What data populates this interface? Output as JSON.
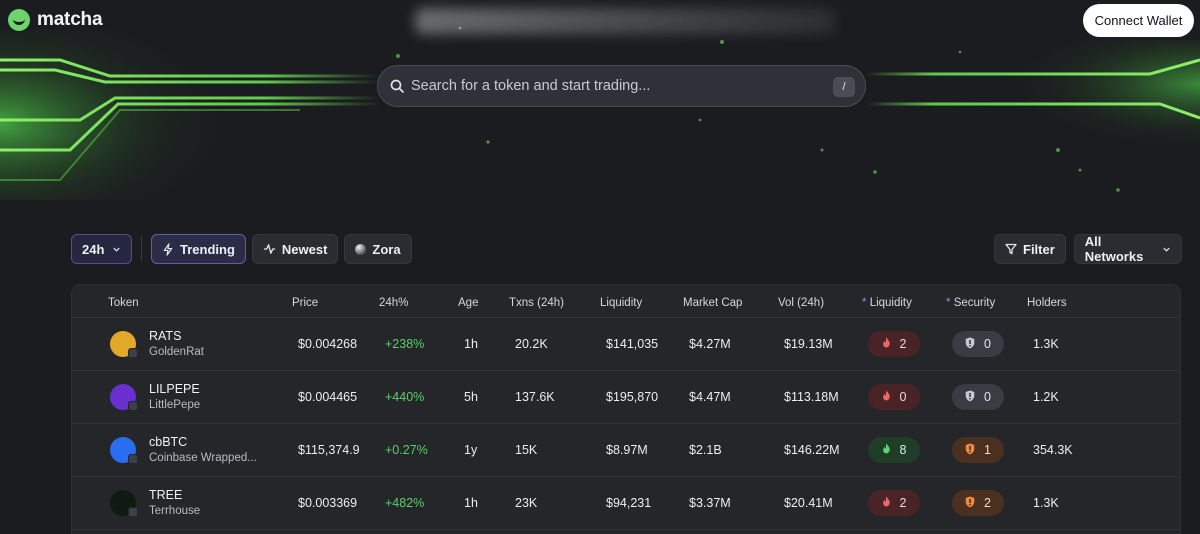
{
  "header": {
    "logo_text": "matcha",
    "connect_label": "Connect Wallet"
  },
  "search": {
    "placeholder": "Search for a token and start trading...",
    "shortcut": "/"
  },
  "filters": {
    "period": "24h",
    "trending": "Trending",
    "newest": "Newest",
    "zora": "Zora",
    "filter": "Filter",
    "networks": "All Networks"
  },
  "table": {
    "headers": {
      "token": "Token",
      "price": "Price",
      "change": "24h%",
      "age": "Age",
      "txns": "Txns (24h)",
      "liquidity": "Liquidity",
      "mcap": "Market Cap",
      "vol": "Vol (24h)",
      "liq_score": "Liquidity",
      "security": "Security",
      "holders": "Holders",
      "star": "*"
    },
    "rows": [
      {
        "symbol": "RATS",
        "name": "GoldenRat",
        "price": "$0.004268",
        "change": "+238%",
        "age": "1h",
        "txns": "20.2K",
        "liquidity": "$141,035",
        "mcap": "$4.27M",
        "vol": "$19.13M",
        "liq_score": "2",
        "liq_tone": "red",
        "security": "0",
        "sec_tone": "gray",
        "holders": "1.3K",
        "avatar_color": "#e3a72a"
      },
      {
        "symbol": "LILPEPE",
        "name": "LittlePepe",
        "price": "$0.004465",
        "change": "+440%",
        "age": "5h",
        "txns": "137.6K",
        "liquidity": "$195,870",
        "mcap": "$4.47M",
        "vol": "$113.18M",
        "liq_score": "0",
        "liq_tone": "red",
        "security": "0",
        "sec_tone": "gray",
        "holders": "1.2K",
        "avatar_color": "#6a2fd0"
      },
      {
        "symbol": "cbBTC",
        "name": "Coinbase Wrapped...",
        "price": "$115,374.9",
        "change": "+0.27%",
        "age": "1y",
        "txns": "15K",
        "liquidity": "$8.97M",
        "mcap": "$2.1B",
        "vol": "$146.22M",
        "liq_score": "8",
        "liq_tone": "green",
        "security": "1",
        "sec_tone": "orange",
        "holders": "354.3K",
        "avatar_color": "#2b6df0"
      },
      {
        "symbol": "TREE",
        "name": "Terrhouse",
        "price": "$0.003369",
        "change": "+482%",
        "age": "1h",
        "txns": "23K",
        "liquidity": "$94,231",
        "mcap": "$3.37M",
        "vol": "$20.41M",
        "liq_score": "2",
        "liq_tone": "red",
        "security": "2",
        "sec_tone": "orange",
        "holders": "1.3K",
        "avatar_color": "#0f1a12"
      }
    ]
  }
}
